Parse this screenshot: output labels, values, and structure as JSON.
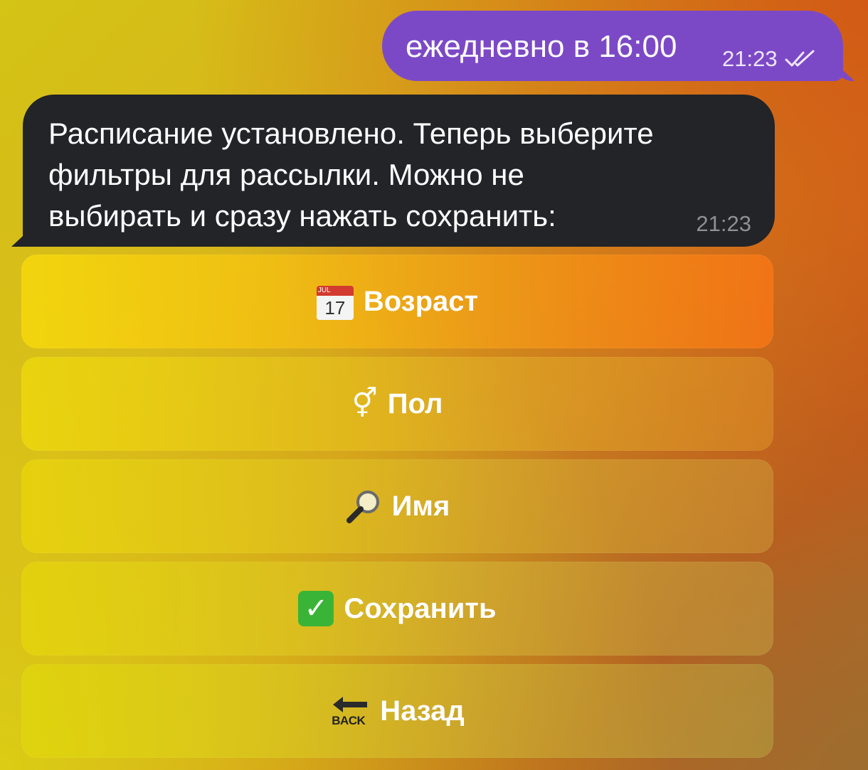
{
  "outgoing_message": {
    "text": "ежедневно в 16:00",
    "time": "21:23",
    "status_icon": "double-check-icon"
  },
  "incoming_message": {
    "text": "Расписание установлено. Теперь выберите\nфильтры для рассылки. Можно не\nвыбирать и сразу нажать сохранить:",
    "time": "21:23"
  },
  "keyboard": {
    "buttons": [
      {
        "icon": "calendar-icon",
        "icon_text": "17",
        "icon_month": "JUL",
        "label": "Возраст"
      },
      {
        "icon": "gender-icon",
        "icon_text": "⚥",
        "label": "Пол"
      },
      {
        "icon": "magnifier-icon",
        "label": "Имя"
      },
      {
        "icon": "check-mark-button-icon",
        "icon_text": "✓",
        "label": "Сохранить"
      },
      {
        "icon": "back-arrow-icon",
        "icon_text": "BACK",
        "label": "Назад"
      }
    ]
  },
  "colors": {
    "outgoing_bubble": "#7c49c6",
    "incoming_bubble": "#222427"
  }
}
